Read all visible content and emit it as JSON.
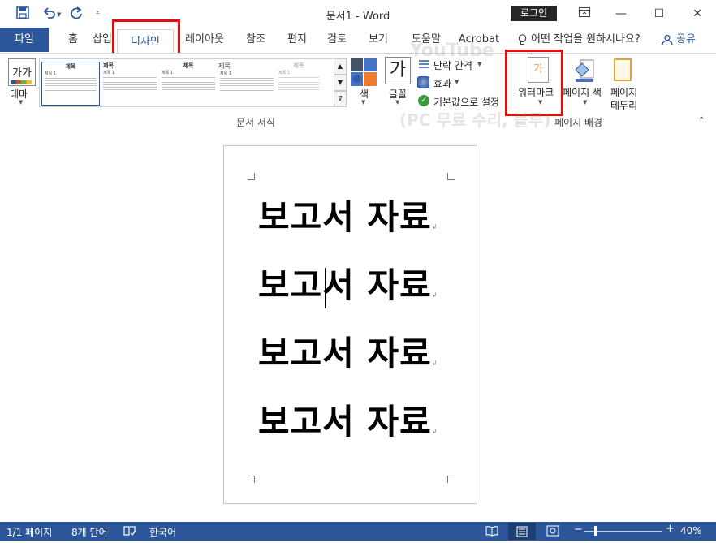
{
  "window": {
    "title": "문서1 - Word",
    "login_label": "로그인"
  },
  "quick_access": [
    "save-icon",
    "undo-icon",
    "redo-icon",
    "customize-icon"
  ],
  "tabs": {
    "file": "파일",
    "items": [
      "홈",
      "삽입",
      "디자인",
      "레이아웃",
      "참조",
      "편지",
      "검토",
      "보기",
      "도움말",
      "Acrobat"
    ],
    "active": "디자인",
    "tell_me": "어떤 작업을 원하시나요?",
    "share": "공유"
  },
  "ribbon": {
    "theme_label": "테마",
    "theme_icon_text": "가가",
    "gallery": [
      {
        "title": "제목",
        "heading": "제목 1"
      },
      {
        "title": "제목",
        "heading": "제목 1"
      },
      {
        "title": "제목",
        "heading": "제목 1"
      },
      {
        "title": "제목",
        "heading": "제목 1"
      },
      {
        "title": "제목",
        "heading": "제목 1"
      }
    ],
    "colors_label": "색",
    "fonts_icon_text": "가",
    "fonts_label": "글꼴",
    "paragraph_spacing_label": "단락 간격",
    "effects_label": "효과",
    "set_default_label": "기본값으로 설정",
    "doc_format_group": "문서 서식",
    "watermark_label": "워터마크",
    "watermark_icon_text": "가",
    "page_color_label": "페이지 색",
    "page_borders_label_1": "페이지",
    "page_borders_label_2": "테두리",
    "page_background_group": "페이지 배경"
  },
  "document": {
    "lines": [
      "보고서 자료",
      "보고서 자료",
      "보고서 자료",
      "보고서 자료"
    ]
  },
  "status": {
    "page": "1/1 페이지",
    "words": "8개 단어",
    "language": "한국어",
    "zoom": "40%"
  },
  "overlay_watermark": {
    "line1": "YouTube",
    "line2": "(PC 무료 수리, 블루)"
  },
  "colors": {
    "brand": "#2b579a",
    "highlight": "#e01010"
  }
}
